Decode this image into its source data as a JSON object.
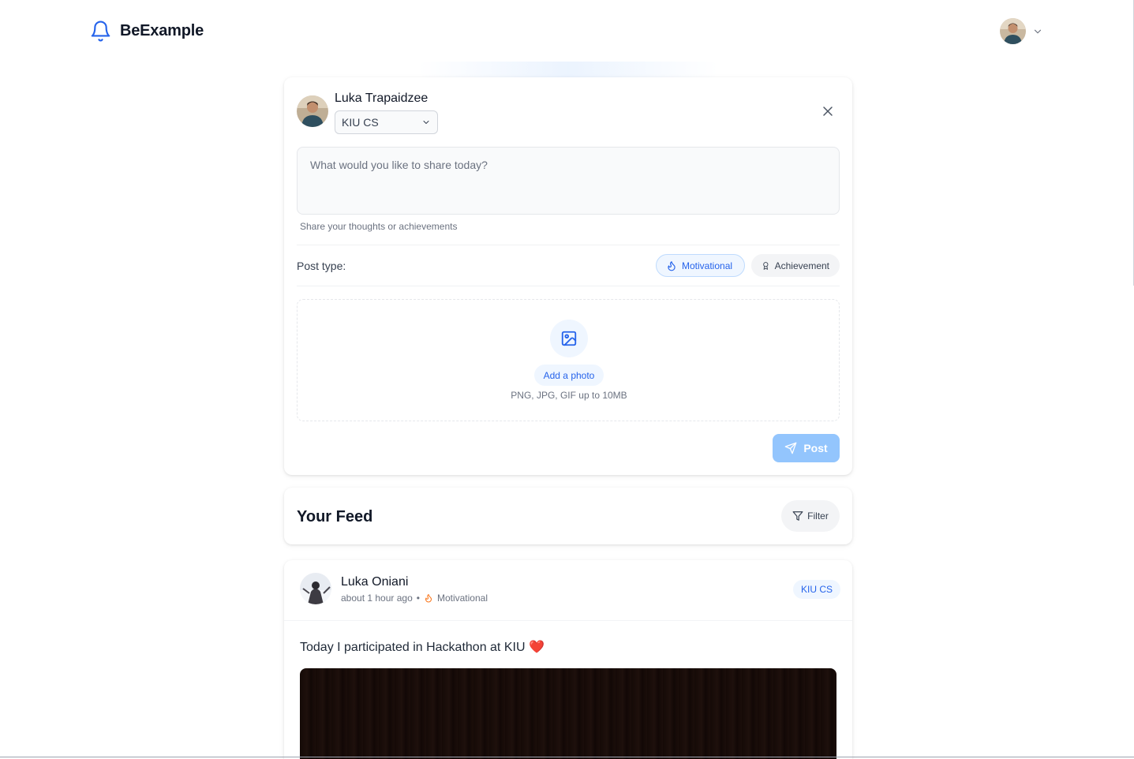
{
  "app": {
    "name": "BeExample",
    "brand_color": "#2563eb"
  },
  "header": {
    "user_menu_icon": "chevron-down-icon",
    "avatar_icon": "user-avatar"
  },
  "composer": {
    "author_name": "Luka Trapaidzee",
    "group_selected": "KIU CS",
    "textarea_placeholder": "What would you like to share today?",
    "helper_text": "Share your thoughts or achievements",
    "post_type_label": "Post type:",
    "post_types": [
      {
        "label": "Motivational",
        "icon": "flame-icon",
        "selected": true
      },
      {
        "label": "Achievement",
        "icon": "award-icon",
        "selected": false
      }
    ],
    "add_photo_label": "Add a photo",
    "file_hint": "PNG, JPG, GIF up to 10MB",
    "post_button_label": "Post"
  },
  "feed": {
    "title": "Your Feed",
    "filter_label": "Filter",
    "posts": [
      {
        "author": "Luka Oniani",
        "time": "about 1 hour ago",
        "separator": "•",
        "type": "Motivational",
        "group": "KIU CS",
        "text": "Today I participated in Hackathon at KIU ❤️"
      }
    ]
  }
}
